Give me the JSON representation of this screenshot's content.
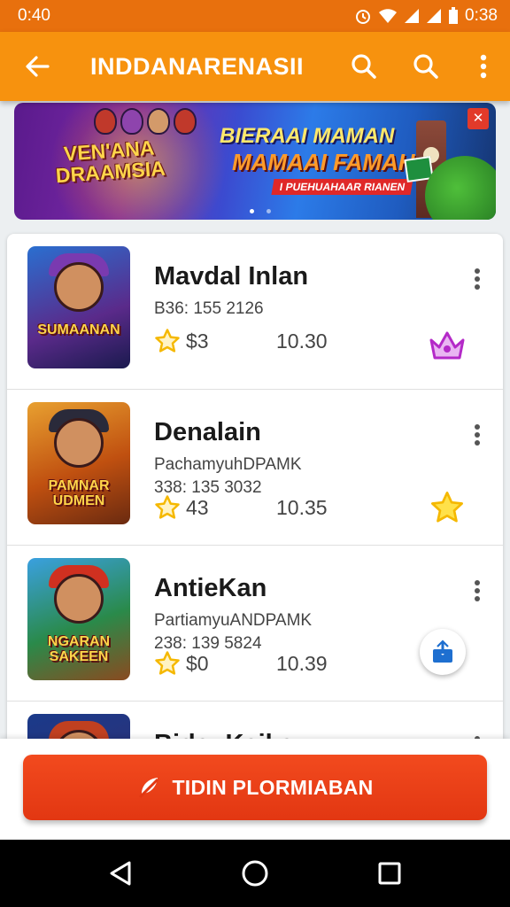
{
  "status": {
    "time_left": "0:40",
    "time_right": "0:38"
  },
  "app_bar": {
    "title": "INDDANARENASII"
  },
  "banner": {
    "logo_line1": "VEN'ANA",
    "logo_line2": "DRAAMSIA",
    "title_line1": "BIERAAI MAMAN",
    "title_line2": "MAMAAI FAMAHI",
    "subtitle": "I PUEHUAHAAR RIANEN",
    "corner_badge": "✕"
  },
  "items": [
    {
      "name": "Mavdal Inlan",
      "line1": "B36: 155 2126",
      "line2": "",
      "rating": "$3",
      "value": "10.30",
      "thumb_text": "SUMAANAN",
      "badge_icon": "crown-icon"
    },
    {
      "name": "Denalain",
      "line1": "PachamyuhDPAMK",
      "line2": "338: 135 3032",
      "rating": "43",
      "value": "10.35",
      "thumb_text": "PAMNAR UDMEN",
      "badge_icon": "star-badge-icon"
    },
    {
      "name": "AntieKan",
      "line1": "PartiamyuANDPAMK",
      "line2": "238: 139 5824",
      "rating": "$0",
      "value": "10.39",
      "thumb_text": "NGARAN SAKEEN",
      "badge_icon": "share-icon"
    },
    {
      "name": "BidauKaika",
      "line1": "",
      "line2": "",
      "rating": "",
      "value": "",
      "thumb_text": "",
      "badge_icon": ""
    }
  ],
  "cta": {
    "label": "TIDIN PLORMIABAN"
  },
  "colors": {
    "primary": "#f7920e",
    "status_bar": "#e8700d",
    "cta": "#e83a14",
    "star": "#f5b800"
  }
}
